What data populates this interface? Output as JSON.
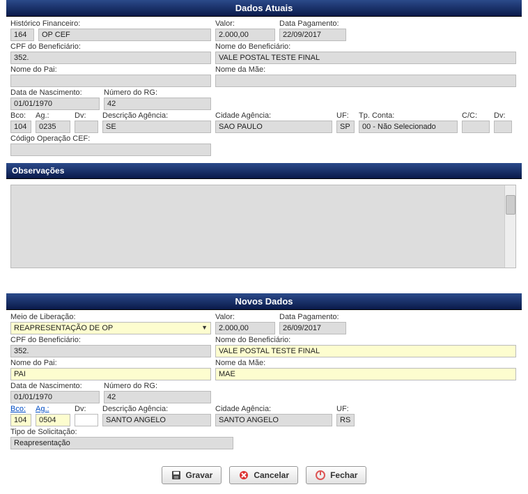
{
  "headers": {
    "dados_atuais": "Dados Atuais",
    "observacoes": "Observações",
    "novos_dados": "Novos Dados"
  },
  "atuais": {
    "historico_label": "Histórico Financeiro:",
    "historico_cod": "164",
    "historico_desc": "OP CEF",
    "valor_label": "Valor:",
    "valor": "2.000,00",
    "data_pag_label": "Data Pagamento:",
    "data_pag": "22/09/2017",
    "cpf_label": "CPF do Beneficiário:",
    "cpf": "352.",
    "nome_benef_label": "Nome do Beneficiário:",
    "nome_benef": "VALE POSTAL TESTE FINAL",
    "nome_pai_label": "Nome do Pai:",
    "nome_pai": "",
    "nome_mae_label": "Nome da Mãe:",
    "nome_mae": "",
    "data_nasc_label": "Data de Nascimento:",
    "data_nasc": "01/01/1970",
    "rg_label": "Número do RG:",
    "rg": "42",
    "bco_label": "Bco:",
    "bco": "104",
    "ag_label": "Ag.:",
    "ag": "0235",
    "dv_label": "Dv:",
    "dv": "",
    "desc_ag_label": "Descrição Agência:",
    "desc_ag": "SE",
    "cidade_ag_label": "Cidade Agência:",
    "cidade_ag": "SAO PAULO",
    "uf_label": "UF:",
    "uf": "SP",
    "tp_conta_label": "Tp. Conta:",
    "tp_conta": "00 - Não Selecionado",
    "cc_label": "C/C:",
    "cc": "",
    "dv2_label": "Dv:",
    "dv2": "",
    "cod_op_label": "Código Operação CEF:",
    "cod_op": ""
  },
  "novos": {
    "meio_lib_label": "Meio de Liberação:",
    "meio_lib": "REAPRESENTAÇÃO DE OP",
    "valor_label": "Valor:",
    "valor": "2.000,00",
    "data_pag_label": "Data Pagamento:",
    "data_pag": "26/09/2017",
    "cpf_label": "CPF do Beneficiário:",
    "cpf": "352.",
    "nome_benef_label": "Nome do Beneficiário:",
    "nome_benef": "VALE POSTAL TESTE FINAL",
    "nome_pai_label": "Nome do Pai:",
    "nome_pai": "PAI",
    "nome_mae_label": "Nome da Mãe:",
    "nome_mae": "MAE",
    "data_nasc_label": "Data de Nascimento:",
    "data_nasc": "01/01/1970",
    "rg_label": "Número do RG:",
    "rg": "42",
    "bco_label": "Bco:",
    "bco": "104",
    "ag_label": "Ag.:",
    "ag": "0504",
    "dv_label": "Dv:",
    "dv": "",
    "desc_ag_label": "Descrição Agência:",
    "desc_ag": "SANTO ANGELO",
    "cidade_ag_label": "Cidade Agência:",
    "cidade_ag": "SANTO ANGELO",
    "uf_label": "UF:",
    "uf": "RS",
    "tipo_sol_label": "Tipo de Solicitação:",
    "tipo_sol": "Reapresentação"
  },
  "buttons": {
    "gravar": "Gravar",
    "cancelar": "Cancelar",
    "fechar": "Fechar"
  }
}
